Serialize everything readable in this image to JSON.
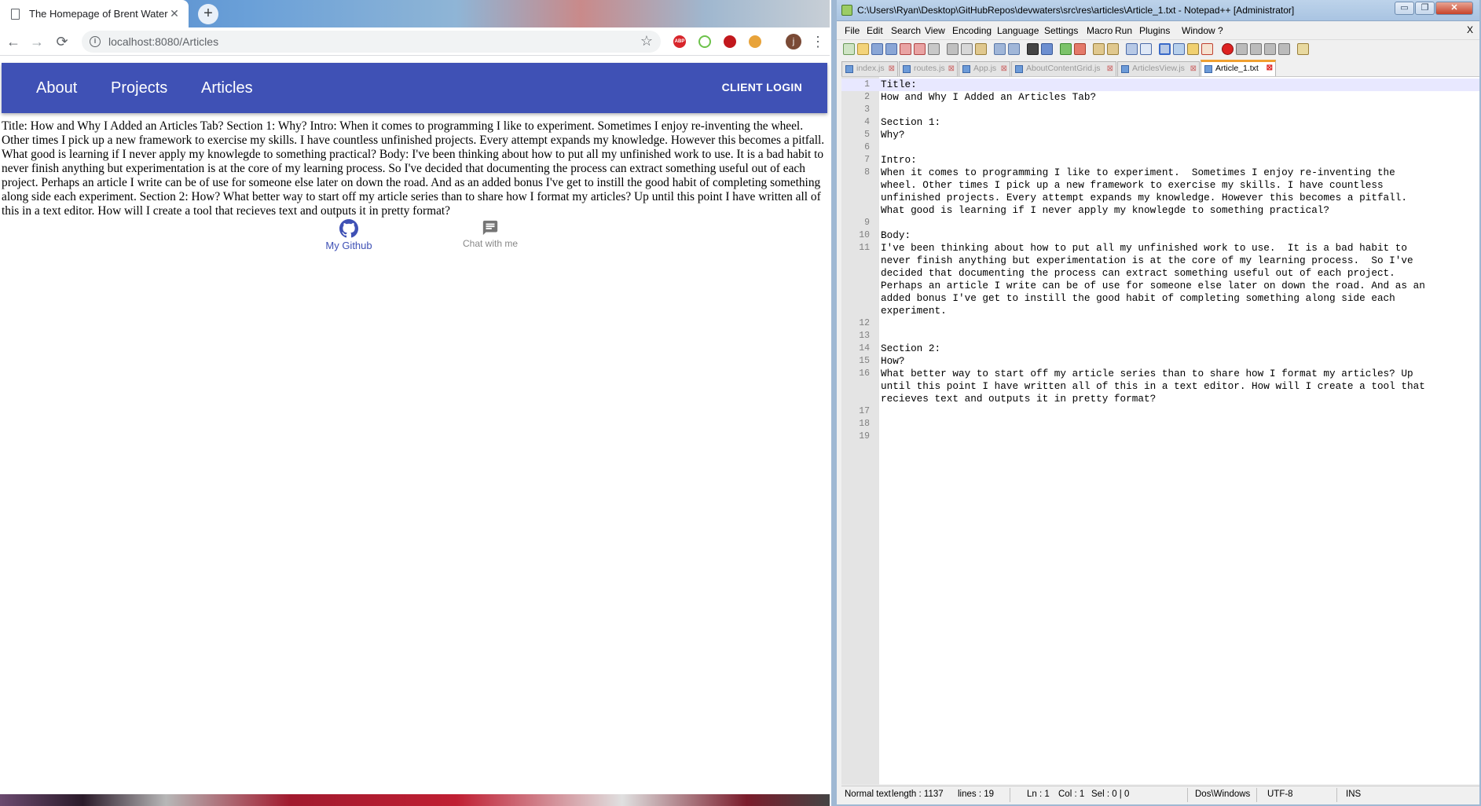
{
  "browser": {
    "tab_title": "The Homepage of Brent Waters",
    "tab_close": "✕",
    "new_tab": "+",
    "url": "localhost:8080/Articles",
    "back": "←",
    "forward": "→",
    "reload": "⟳",
    "star": "☆",
    "ext_abp": "ABP",
    "avatar_letter": "j",
    "menu": "⋮"
  },
  "site": {
    "nav": [
      "About",
      "Projects",
      "Articles"
    ],
    "login": "CLIENT LOGIN",
    "article_text": "Title: How and Why I Added an Articles Tab?  Section 1: Why?  Intro: When it comes to programming I like to experiment. Sometimes I enjoy re-inventing the wheel. Other times I pick up a new framework to exercise my skills. I have countless unfinished projects. Every attempt expands my knowledge. However this becomes a pitfall. What good is learning if I never apply my knowlegde to something practical?  Body: I've been thinking about how to put all my unfinished work to use. It is a bad habit to never finish anything but experimentation is at the core of my learning process. So I've decided that documenting the process can extract something useful out of each project. Perhaps an article I write can be of use for someone else later on down the road. And as an added bonus I've get to instill the good habit of completing something along side each experiment.   Section 2: How? What better way to start off my article series than to share how I format my articles? Up until this point I have written all of this in a text editor. How will I create a tool that recieves text and outputs it in pretty format?",
    "github_label": "My Github",
    "chat_label": "Chat with me",
    "brand_color": "#3f51b5"
  },
  "npp": {
    "title": "C:\\Users\\Ryan\\Desktop\\GitHubRepos\\devwaters\\src\\res\\articles\\Article_1.txt - Notepad++ [Administrator]",
    "win_min": "▭",
    "win_max": "❐",
    "win_close": "✕",
    "menu": [
      "File",
      "Edit",
      "Search",
      "View",
      "Encoding",
      "Language",
      "Settings",
      "Macro",
      "Run",
      "Plugins",
      "Window",
      "?"
    ],
    "menu_close": "X",
    "tabs": [
      "index.js",
      "routes.js",
      "App.js",
      "AboutContentGrid.js",
      "ArticlesView.js",
      "Article_1.txt"
    ],
    "active_tab": 5,
    "tab_close": "⊠",
    "lines": [
      {
        "n": "1",
        "text": "Title:"
      },
      {
        "n": "2",
        "text": "How and Why I Added an Articles Tab?"
      },
      {
        "n": "3",
        "text": ""
      },
      {
        "n": "4",
        "text": "Section 1:"
      },
      {
        "n": "5",
        "text": "Why?"
      },
      {
        "n": "6",
        "text": ""
      },
      {
        "n": "7",
        "text": "Intro:"
      },
      {
        "n": "8",
        "text": "When it comes to programming I like to experiment.  Sometimes I enjoy re-inventing the"
      },
      {
        "n": "",
        "text": "wheel. Other times I pick up a new framework to exercise my skills. I have countless"
      },
      {
        "n": "",
        "text": "unfinished projects. Every attempt expands my knowledge. However this becomes a pitfall."
      },
      {
        "n": "",
        "text": "What good is learning if I never apply my knowlegde to something practical?"
      },
      {
        "n": "9",
        "text": ""
      },
      {
        "n": "10",
        "text": "Body:"
      },
      {
        "n": "11",
        "text": "I've been thinking about how to put all my unfinished work to use.  It is a bad habit to"
      },
      {
        "n": "",
        "text": "never finish anything but experimentation is at the core of my learning process.  So I've"
      },
      {
        "n": "",
        "text": "decided that documenting the process can extract something useful out of each project."
      },
      {
        "n": "",
        "text": "Perhaps an article I write can be of use for someone else later on down the road. And as an"
      },
      {
        "n": "",
        "text": "added bonus I've get to instill the good habit of completing something along side each"
      },
      {
        "n": "",
        "text": "experiment."
      },
      {
        "n": "12",
        "text": ""
      },
      {
        "n": "13",
        "text": ""
      },
      {
        "n": "14",
        "text": "Section 2:"
      },
      {
        "n": "15",
        "text": "How?"
      },
      {
        "n": "16",
        "text": "What better way to start off my article series than to share how I format my articles? Up"
      },
      {
        "n": "",
        "text": "until this point I have written all of this in a text editor. How will I create a tool that"
      },
      {
        "n": "",
        "text": "recieves text and outputs it in pretty format?"
      },
      {
        "n": "17",
        "text": ""
      },
      {
        "n": "18",
        "text": ""
      },
      {
        "n": "19",
        "text": ""
      }
    ],
    "status": {
      "type": "Normal text",
      "length": "length : 1137",
      "lines": "lines : 19",
      "ln": "Ln : 1",
      "col": "Col : 1",
      "sel": "Sel : 0 | 0",
      "eol": "Dos\\Windows",
      "encoding": "UTF-8",
      "mode": "INS"
    }
  }
}
